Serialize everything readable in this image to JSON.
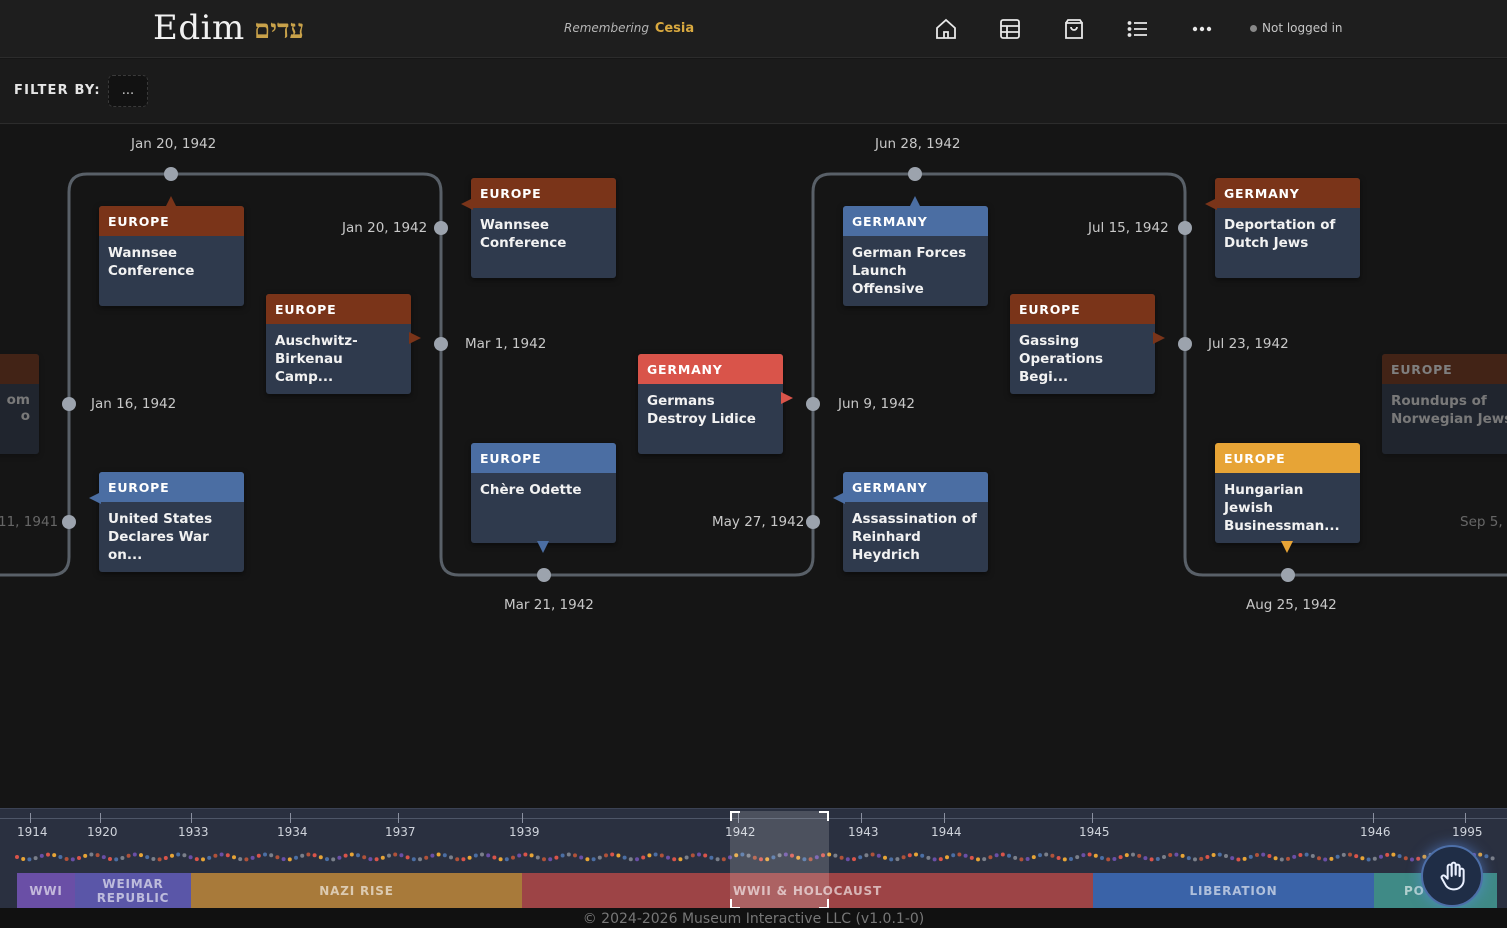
{
  "header": {
    "brand": "Edim",
    "brand_hebrew": "עדים",
    "remembering_label": "Remembering",
    "remembering_name": "Cesia",
    "login_status": "Not logged in",
    "nav_icons": [
      "home-icon",
      "catalog-icon",
      "shopping-bag-icon",
      "list-icon",
      "more-icon"
    ]
  },
  "filter": {
    "label": "FILTER BY:",
    "button": "..."
  },
  "timeline": {
    "dates": [
      "Jan 20, 1942",
      "Jan 20, 1942",
      "Mar 1, 1942",
      "Jan 16, 1942",
      "11, 1941",
      "Mar 21, 1942",
      "Jun 28, 1942",
      "Jun 9, 1942",
      "May 27, 1942",
      "Jul 15, 1942",
      "Jul 23, 1942",
      "Aug 25, 1942",
      "Sep 5,"
    ],
    "cards": [
      {
        "category": "EUROPE",
        "title": "Wannsee Conference",
        "color": "#7a3419"
      },
      {
        "category": "EUROPE",
        "title": "Wannsee Conference",
        "color": "#7a3419"
      },
      {
        "category": "EUROPE",
        "title": "Auschwitz-Birkenau Camp...",
        "color": "#7a3419"
      },
      {
        "category": "GERMANY",
        "title": "Germans Destroy Lidice",
        "color": "#d9544a"
      },
      {
        "category": "EUROPE",
        "title": "United States Declares War on...",
        "color": "#4b6ea3"
      },
      {
        "category": "EUROPE",
        "title": "Chère Odette",
        "color": "#4b6ea3"
      },
      {
        "category": "GERMANY",
        "title": "German Forces Launch Offensive",
        "color": "#4b6ea3"
      },
      {
        "category": "GERMANY",
        "title": "Assassination of Reinhard Heydrich",
        "color": "#4b6ea3"
      },
      {
        "category": "GERMANY",
        "title": "Deportation of Dutch Jews",
        "color": "#7a3419"
      },
      {
        "category": "EUROPE",
        "title": "Gassing Operations Begi...",
        "color": "#7a3419"
      },
      {
        "category": "EUROPE",
        "title": "Hungarian Jewish Businessman...",
        "color": "#e7a436"
      },
      {
        "category": "EUROPE",
        "title": "Roundups of Norwegian Jews",
        "color": "#7a3419"
      },
      {
        "category": "",
        "title": "om\no",
        "color": "#7a3419"
      }
    ]
  },
  "minimap": {
    "years": [
      "1914",
      "1920",
      "1933",
      "1934",
      "1937",
      "1939",
      "1942",
      "1943",
      "1944",
      "1945",
      "1946",
      "1995"
    ],
    "eras": [
      {
        "name": "WWI",
        "color": "#6a4fa6"
      },
      {
        "name": "WEIMAR REPUBLIC",
        "color": "#5a56a8"
      },
      {
        "name": "NAZI RISE",
        "color": "#a87a3a"
      },
      {
        "name": "WWII & HOLOCAUST",
        "color": "#9d4446"
      },
      {
        "name": "LIBERATION",
        "color": "#3a63a8"
      },
      {
        "name": "PO",
        "color": "#3f8a86"
      }
    ],
    "hand_icon": "hand-pointer-icon"
  },
  "footer": {
    "copyright": "© 2024-2026 Museum Interactive LLC (v1.0.1-0)"
  }
}
